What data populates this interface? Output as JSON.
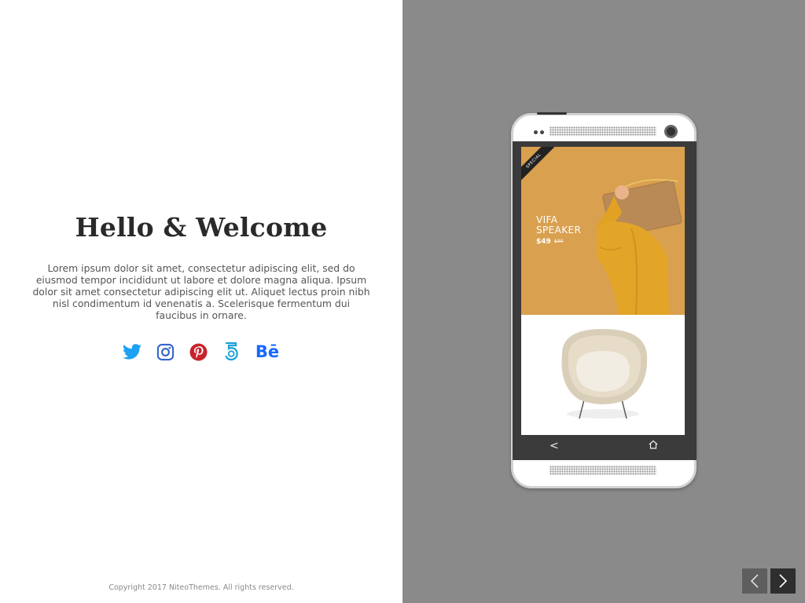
{
  "intro": {
    "title": "Hello & Welcome",
    "description": "Lorem ipsum dolor sit amet, consectetur adipiscing elit, sed do eiusmod tempor incididunt ut labore et dolore magna aliqua. Ipsum dolor sit amet consectetur adipiscing elit ut. Aliquet lectus proin nibh nisl condimentum id venenatis a. Scelerisque fermentum dui faucibus in ornare."
  },
  "social": {
    "icons": [
      "twitter-icon",
      "instagram-icon",
      "pinterest-icon",
      "500px-icon",
      "behance-icon"
    ],
    "behance_label": "Bē",
    "colors": {
      "twitter": "#1da1f2",
      "instagram": "#3366cc",
      "pinterest": "#c8232c",
      "fivehundredpx": "#1aa0d8",
      "behance": "#1769ff"
    }
  },
  "footer": {
    "copyright": "Copyright 2017 NiteoThemes. All rights reserved."
  },
  "phone_screen": {
    "ribbon": "SPECIAL",
    "product_name": "VIFA SPEAKER",
    "price": "$49",
    "old_price": "$90",
    "nav_back": "<"
  },
  "colors": {
    "right_panel_bg": "#8a8a8a",
    "hero_bg": "#d9a04f"
  },
  "slider": {
    "prev_label": "previous",
    "next_label": "next"
  }
}
